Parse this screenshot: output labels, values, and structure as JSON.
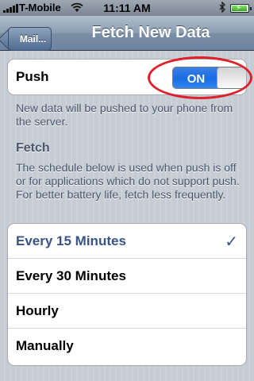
{
  "status_bar": {
    "carrier": "T-Mobile",
    "time": "11:11 AM",
    "icons": [
      "signal-bars-icon",
      "wifi-icon",
      "bluetooth-icon",
      "battery-charging-icon"
    ]
  },
  "nav": {
    "back_label": "Mail...",
    "title": "Fetch New Data"
  },
  "push": {
    "label": "Push",
    "toggle_text": "ON",
    "state": "on",
    "description": "New data will be pushed to your phone from the server."
  },
  "fetch": {
    "title": "Fetch",
    "description": "The schedule below is used when push is off or for applications which do not support push. For better battery life, fetch less frequently.",
    "options": [
      {
        "label": "Every 15 Minutes",
        "selected": true
      },
      {
        "label": "Every 30 Minutes",
        "selected": false
      },
      {
        "label": "Hourly",
        "selected": false
      },
      {
        "label": "Manually",
        "selected": false
      }
    ],
    "check_glyph": "✓"
  },
  "colors": {
    "highlight_ring": "#e0212b",
    "toggle_blue": "#176de4",
    "selected_text": "#385487"
  }
}
